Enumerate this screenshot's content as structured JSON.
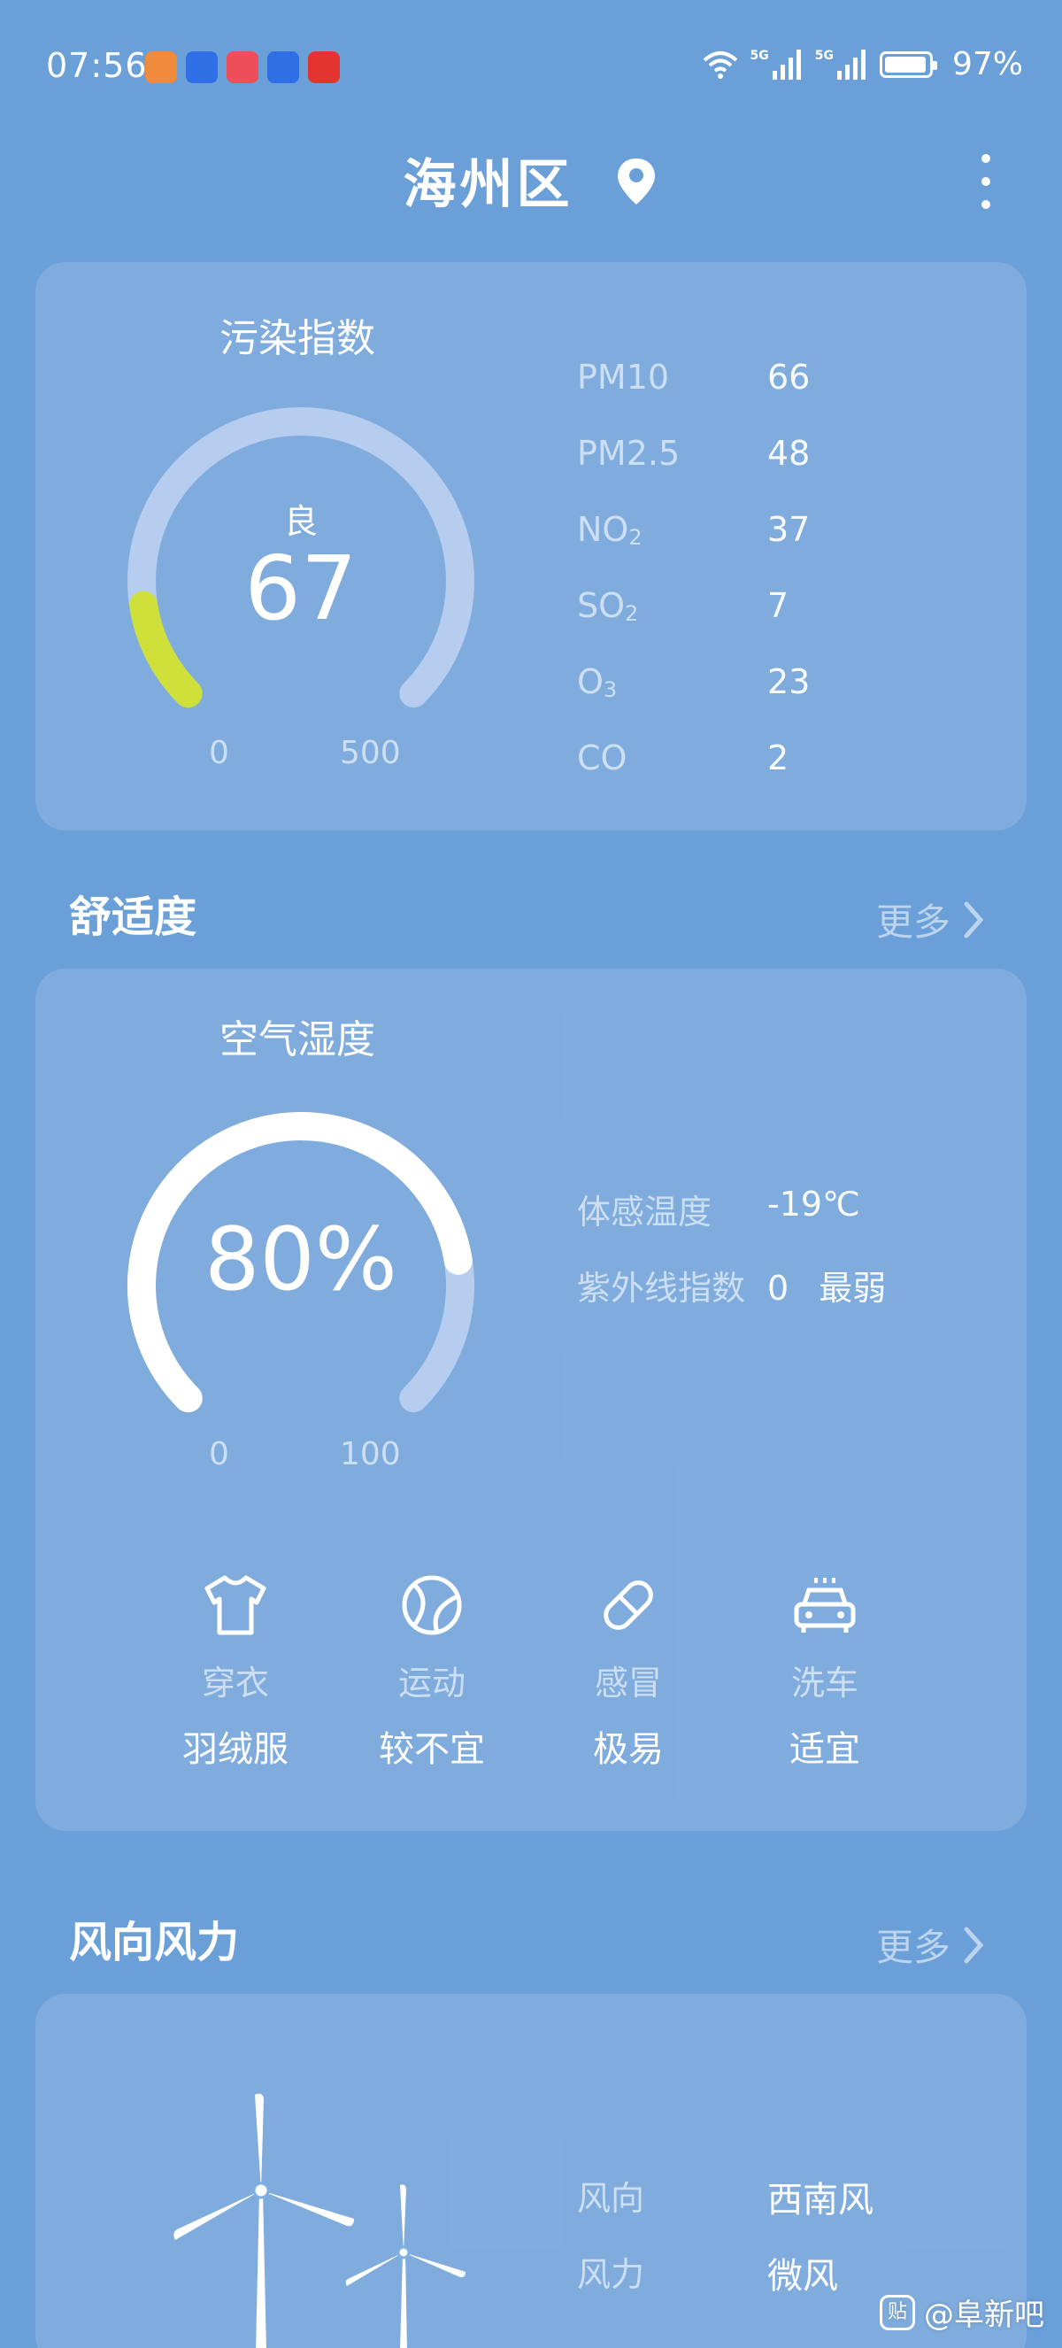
{
  "status_bar": {
    "time": "07:56",
    "battery": "97%",
    "signal_1": "5G",
    "signal_2": "5G",
    "app_icons": [
      "health-app-icon",
      "baidu-app-icon",
      "xiaohongshu-app-icon",
      "baidu-app-icon",
      "pinduoduo-app-icon"
    ]
  },
  "header": {
    "location": "海州区"
  },
  "pollution": {
    "title": "污染指数",
    "quality": "良",
    "aqi": "67",
    "aqi_fraction": 0.134,
    "scale_min": "0",
    "scale_max": "500",
    "metrics": [
      {
        "name": "PM10",
        "sub": "",
        "value": "66"
      },
      {
        "name": "PM2.5",
        "sub": "",
        "value": "48"
      },
      {
        "name": "NO",
        "sub": "2",
        "value": "37"
      },
      {
        "name": "SO",
        "sub": "2",
        "value": "7"
      },
      {
        "name": "O",
        "sub": "3",
        "value": "23"
      },
      {
        "name": "CO",
        "sub": "",
        "value": "2"
      }
    ]
  },
  "comfort": {
    "section_title": "舒适度",
    "more": "更多",
    "humidity_title": "空气湿度",
    "humidity": "80%",
    "humidity_fraction": 0.8,
    "scale_min": "0",
    "scale_max": "100",
    "feels_like_label": "体感温度",
    "feels_like_value": "-19℃",
    "uv_label": "紫外线指数",
    "uv_value": "0",
    "uv_level": "最弱",
    "items": [
      {
        "icon": "shirt-icon",
        "label": "穿衣",
        "value": "羽绒服"
      },
      {
        "icon": "ball-icon",
        "label": "运动",
        "value": "较不宜"
      },
      {
        "icon": "pill-icon",
        "label": "感冒",
        "value": "极易"
      },
      {
        "icon": "car-wash-icon",
        "label": "洗车",
        "value": "适宜"
      }
    ]
  },
  "wind": {
    "section_title": "风向风力",
    "more": "更多",
    "direction_label": "风向",
    "direction_value": "西南风",
    "force_label": "风力",
    "force_value": "微风"
  },
  "watermark": {
    "icon_text": "贴",
    "text": "@阜新吧"
  },
  "colors": {
    "background": "#6a9fd8",
    "aqi_arc": "#cfe03a",
    "gauge_track": "#b6cdf0"
  }
}
